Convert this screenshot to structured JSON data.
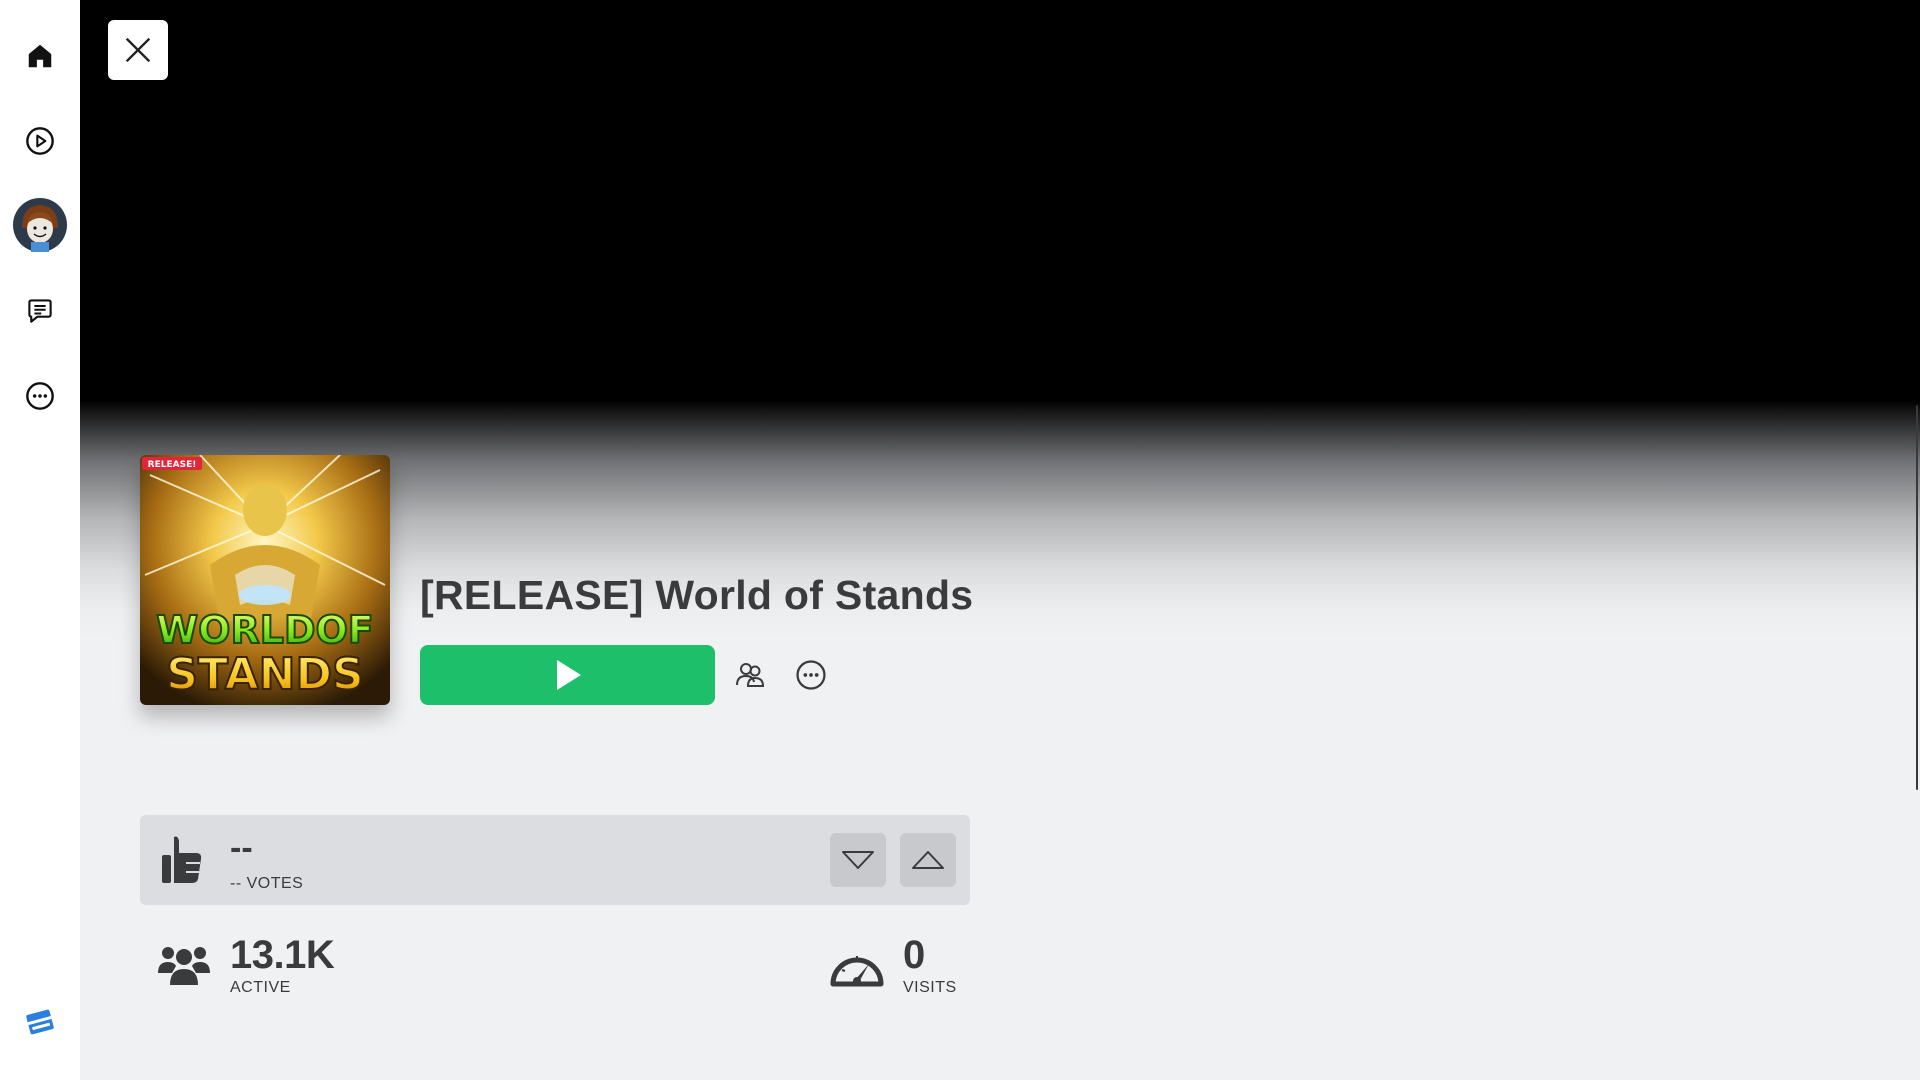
{
  "sidebar": {
    "items": [
      {
        "name": "home",
        "icon": "home-icon"
      },
      {
        "name": "discover",
        "icon": "play-circle-icon"
      },
      {
        "name": "avatar",
        "icon": "avatar-icon"
      },
      {
        "name": "chat",
        "icon": "chat-icon"
      },
      {
        "name": "more",
        "icon": "more-icon"
      }
    ],
    "logo_icon": "roblox-logo-icon"
  },
  "game": {
    "title": "[RELEASE] World of Stands",
    "thumbnail": {
      "badge": "RELEASE!",
      "logo_line1": "WORLDOF",
      "logo_line2": "STANDS"
    }
  },
  "actions": {
    "play_icon": "play-icon",
    "party_icon": "party-icon",
    "more_icon": "more-icon"
  },
  "votes": {
    "value": "--",
    "label": "-- VOTES"
  },
  "stats": {
    "active_value": "13.1K",
    "active_label": "ACTIVE",
    "visits_value": "0",
    "visits_label": "VISITS"
  },
  "colors": {
    "play": "#1dbf6b",
    "text": "#393b3d",
    "background": "#f0f1f3"
  }
}
